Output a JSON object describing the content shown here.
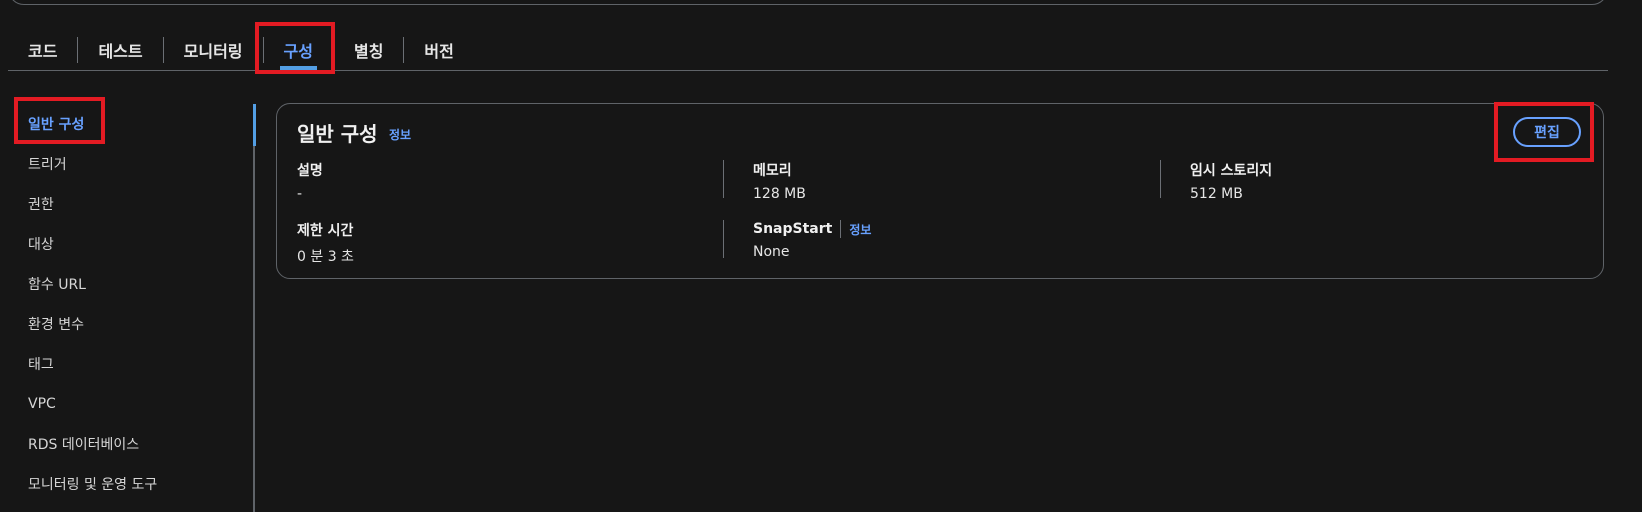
{
  "tabs": [
    {
      "label": "코드"
    },
    {
      "label": "테스트"
    },
    {
      "label": "모니터링"
    },
    {
      "label": "구성"
    },
    {
      "label": "별칭"
    },
    {
      "label": "버전"
    }
  ],
  "active_tab": "구성",
  "sidebar": {
    "items": [
      {
        "label": "일반 구성"
      },
      {
        "label": "트리거"
      },
      {
        "label": "권한"
      },
      {
        "label": "대상"
      },
      {
        "label": "함수 URL"
      },
      {
        "label": "환경 변수"
      },
      {
        "label": "태그"
      },
      {
        "label": "VPC"
      },
      {
        "label": "RDS 데이터베이스"
      },
      {
        "label": "모니터링 및 운영 도구"
      }
    ]
  },
  "card": {
    "title": "일반 구성",
    "info_label": "정보",
    "edit_label": "편집",
    "fields": {
      "description": {
        "label": "설명",
        "value": "-"
      },
      "memory": {
        "label": "메모리",
        "value": "128  MB"
      },
      "ephemeral_storage": {
        "label": "임시 스토리지",
        "value": "512  MB"
      },
      "timeout": {
        "label": "제한 시간",
        "value": "0  분  3  초"
      },
      "snapstart": {
        "label": "SnapStart",
        "info_label": "정보",
        "value": "None"
      }
    }
  },
  "colors": {
    "accent": "#68a1ff",
    "highlight": "#e31b23",
    "background": "#161616"
  }
}
